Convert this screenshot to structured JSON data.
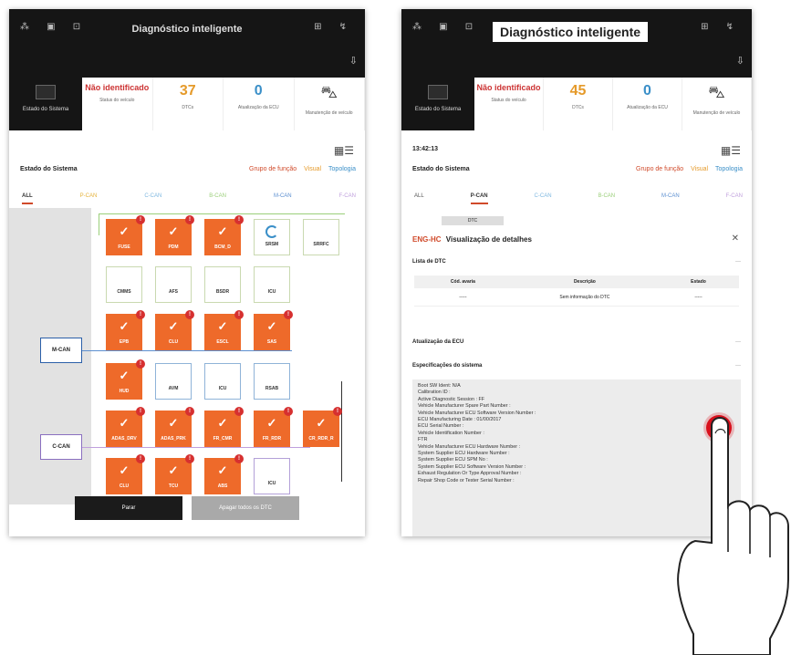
{
  "left": {
    "status_icons": "⁂ ▣ ⊡",
    "status_right": "⊞ ↯",
    "app_title": "Diagnóstico inteligente",
    "home_label": "Estado do Sistema",
    "info": [
      {
        "value": "Não identificado",
        "label": "Status do veículo"
      },
      {
        "value": "37",
        "label": "DTCs"
      },
      {
        "value": "0",
        "label": "Atualização da ECU"
      },
      {
        "value": "",
        "label": "Manutenção de veículo"
      }
    ],
    "system_state": "Estado do Sistema",
    "actions": [
      "Grupo de função",
      "Visual",
      "Topologia"
    ],
    "tabs": [
      "ALL",
      "P-CAN",
      "C-CAN",
      "B-CAN",
      "M-CAN",
      "F-CAN"
    ],
    "gateways": [
      "M-CAN",
      "C-CAN"
    ],
    "ecus": [
      {
        "name": "FUSE",
        "state": "ok"
      },
      {
        "name": "PDM",
        "state": "ok"
      },
      {
        "name": "BCM_D",
        "state": "ok"
      },
      {
        "name": "SRSM",
        "state": "loading"
      },
      {
        "name": "SRRFC",
        "state": "empty"
      },
      {
        "name": "CMMS",
        "state": "empty"
      },
      {
        "name": "AFS",
        "state": "empty"
      },
      {
        "name": "BSDR",
        "state": "empty"
      },
      {
        "name": "ICU",
        "state": "empty"
      },
      {
        "name": "EPB",
        "state": "ok"
      },
      {
        "name": "CLU",
        "state": "ok"
      },
      {
        "name": "ESCL",
        "state": "ok"
      },
      {
        "name": "SAS",
        "state": "ok"
      },
      {
        "name": "HUD",
        "state": "ok"
      },
      {
        "name": "AVM",
        "state": "empty"
      },
      {
        "name": "ICU",
        "state": "empty"
      },
      {
        "name": "RSAB",
        "state": "empty"
      },
      {
        "name": "ADAS_DRV",
        "state": "ok"
      },
      {
        "name": "ADAS_PRK",
        "state": "ok"
      },
      {
        "name": "FR_CMR",
        "state": "ok"
      },
      {
        "name": "FR_RDR",
        "state": "ok"
      },
      {
        "name": "CR_RDR_R",
        "state": "ok"
      },
      {
        "name": "CLU",
        "state": "ok"
      },
      {
        "name": "TCU",
        "state": "ok"
      },
      {
        "name": "ABS",
        "state": "ok"
      },
      {
        "name": "ICU",
        "state": "empty"
      }
    ],
    "btn_back": "Parar",
    "btn_clear": "Apagar todos os DTC"
  },
  "right": {
    "status_icons": "⁂ ▣ ⊡",
    "status_right": "⊞ ↯",
    "app_title": "Diagnóstico inteligente",
    "home_label": "Estado do Sistema",
    "info": [
      {
        "value": "Não identificado",
        "label": "Status do veículo"
      },
      {
        "value": "45",
        "label": "DTCs"
      },
      {
        "value": "0",
        "label": "Atualização da ECU"
      },
      {
        "value": "",
        "label": "Manutenção de veículo"
      }
    ],
    "time": "13:42:13",
    "system_state": "Estado do Sistema",
    "actions": [
      "Grupo de função",
      "Visual",
      "Topologia"
    ],
    "tabs": [
      "ALL",
      "P-CAN",
      "C-CAN",
      "B-CAN",
      "M-CAN",
      "F-CAN"
    ],
    "dtc_tag": "DTC",
    "details_code": "ENG-HC",
    "details_title": "Visualização de detalhes",
    "dtc_list": "Lista de DTC",
    "dtc_headers": [
      "Cód. avaria",
      "Descrição",
      "Estado"
    ],
    "dtc_rows": [
      {
        "code": "-----",
        "desc": "Sem informação do DTC",
        "state": "-----"
      }
    ],
    "ecu_update": "Atualização da ECU",
    "specs_title": "Especificações do sistema",
    "toggle": "—",
    "specs": [
      "Boot SW Ident: N/A",
      "Calibration ID :",
      "Active Diagnostic Session : FF",
      "Vehicle Manufacturer Spare Part Number :",
      "Vehicle Manufacturer ECU Software Version Number :",
      "ECU Manufacturing Date : 01/00/2017",
      "ECU Serial Number :",
      "Vehicle Identification Number :",
      "FTR",
      "Vehicle Manufacturer ECU Hardware Number :",
      "System Supplier ECU Hardware Number :",
      "System Supplier ECU SPM No :",
      "System Supplier ECU Software Version Number :",
      "Exhaust Regulation Or Type Approval Number :",
      "Repair Shop Code or Tester Serial Number :"
    ]
  }
}
